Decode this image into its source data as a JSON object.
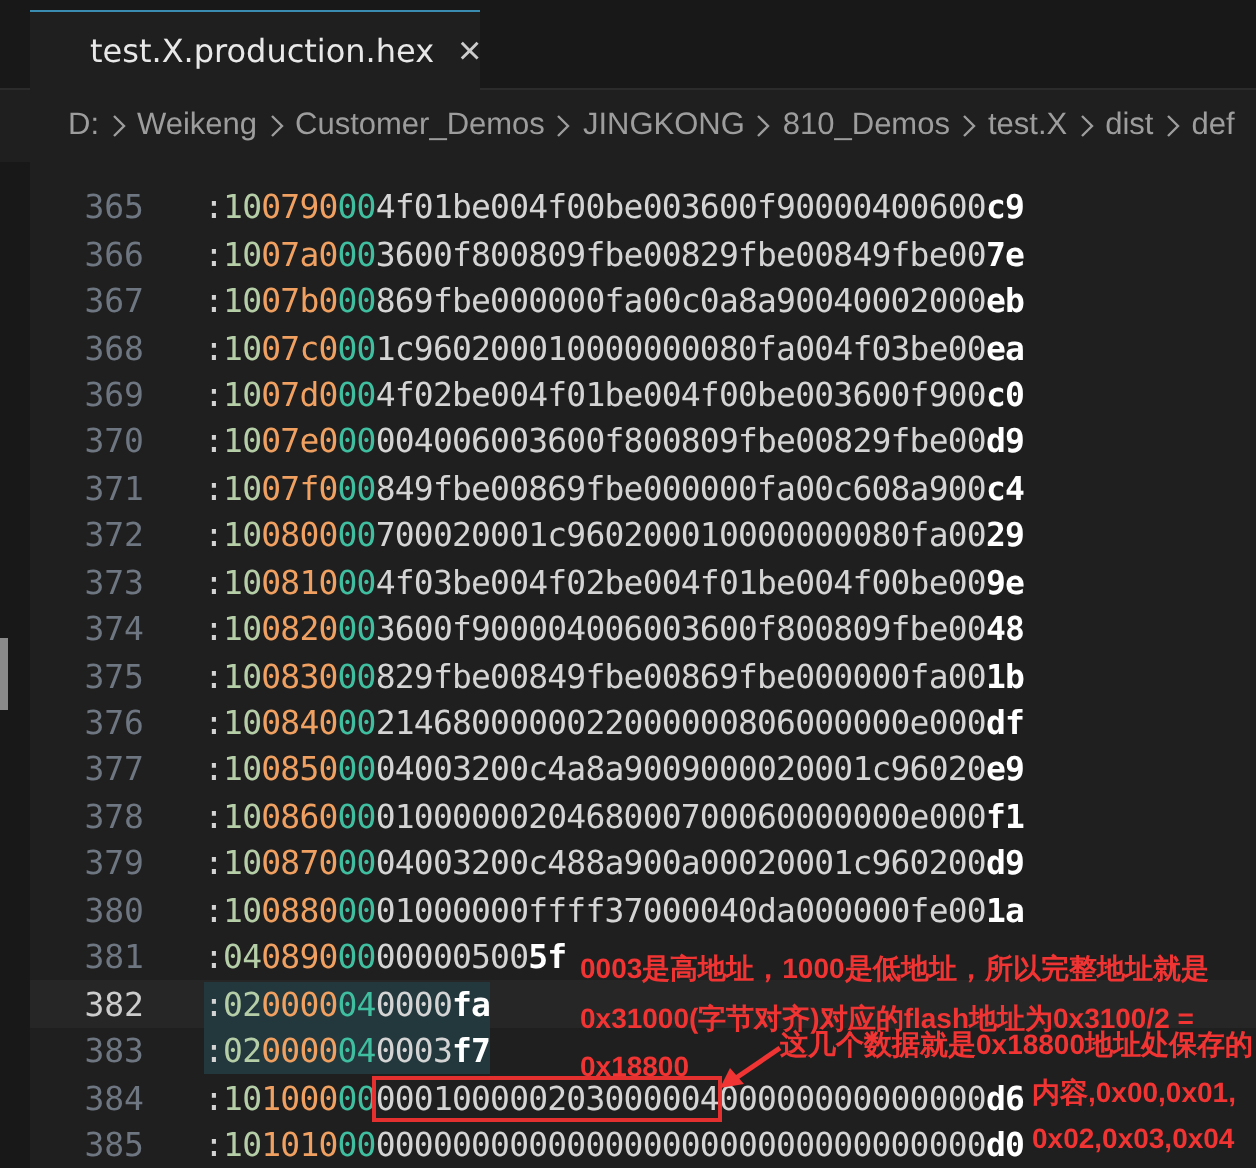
{
  "tab": {
    "title": "test.X.production.hex",
    "close": "×",
    "selected": true
  },
  "breadcrumbs": [
    "D:",
    "Weikeng",
    "Customer_Demos",
    "JINGKONG",
    "810_Demos",
    "test.X",
    "dist",
    "def"
  ],
  "lines": [
    {
      "number": "365",
      "colon": ":",
      "count": "10",
      "address": "0790",
      "type": "00",
      "data": "4f01be004f00be003600f90000400600",
      "checksum": "c9",
      "selected": false,
      "current": false
    },
    {
      "number": "366",
      "colon": ":",
      "count": "10",
      "address": "07a0",
      "type": "00",
      "data": "3600f800809fbe00829fbe00849fbe00",
      "checksum": "7e",
      "selected": false,
      "current": false
    },
    {
      "number": "367",
      "colon": ":",
      "count": "10",
      "address": "07b0",
      "type": "00",
      "data": "869fbe000000fa00c0a8a90040002000",
      "checksum": "eb",
      "selected": false,
      "current": false
    },
    {
      "number": "368",
      "colon": ":",
      "count": "10",
      "address": "07c0",
      "type": "00",
      "data": "1c960200010000000080fa004f03be00",
      "checksum": "ea",
      "selected": false,
      "current": false
    },
    {
      "number": "369",
      "colon": ":",
      "count": "10",
      "address": "07d0",
      "type": "00",
      "data": "4f02be004f01be004f00be003600f900",
      "checksum": "c0",
      "selected": false,
      "current": false
    },
    {
      "number": "370",
      "colon": ":",
      "count": "10",
      "address": "07e0",
      "type": "00",
      "data": "004006003600f800809fbe00829fbe00",
      "checksum": "d9",
      "selected": false,
      "current": false
    },
    {
      "number": "371",
      "colon": ":",
      "count": "10",
      "address": "07f0",
      "type": "00",
      "data": "849fbe00869fbe000000fa00c608a900",
      "checksum": "c4",
      "selected": false,
      "current": false
    },
    {
      "number": "372",
      "colon": ":",
      "count": "10",
      "address": "0800",
      "type": "00",
      "data": "700020001c960200010000000080fa00",
      "checksum": "29",
      "selected": false,
      "current": false
    },
    {
      "number": "373",
      "colon": ":",
      "count": "10",
      "address": "0810",
      "type": "00",
      "data": "4f03be004f02be004f01be004f00be00",
      "checksum": "9e",
      "selected": false,
      "current": false
    },
    {
      "number": "374",
      "colon": ":",
      "count": "10",
      "address": "0820",
      "type": "00",
      "data": "3600f900004006003600f800809fbe00",
      "checksum": "48",
      "selected": false,
      "current": false
    },
    {
      "number": "375",
      "colon": ":",
      "count": "10",
      "address": "0830",
      "type": "00",
      "data": "829fbe00849fbe00869fbe000000fa00",
      "checksum": "1b",
      "selected": false,
      "current": false
    },
    {
      "number": "376",
      "colon": ":",
      "count": "10",
      "address": "0840",
      "type": "00",
      "data": "2146800000022000000806000000e000",
      "checksum": "df",
      "selected": false,
      "current": false
    },
    {
      "number": "377",
      "colon": ":",
      "count": "10",
      "address": "0850",
      "type": "00",
      "data": "04003200c4a8a9009000020001c96020",
      "checksum": "e9",
      "selected": false,
      "current": false
    },
    {
      "number": "378",
      "colon": ":",
      "count": "10",
      "address": "0860",
      "type": "00",
      "data": "0100000020468000700060000000e000",
      "checksum": "f1",
      "selected": false,
      "current": false
    },
    {
      "number": "379",
      "colon": ":",
      "count": "10",
      "address": "0870",
      "type": "00",
      "data": "04003200c488a900a00020001c960200",
      "checksum": "d9",
      "selected": false,
      "current": false
    },
    {
      "number": "380",
      "colon": ":",
      "count": "10",
      "address": "0880",
      "type": "00",
      "data": "01000000ffff37000040da000000fe00",
      "checksum": "1a",
      "selected": false,
      "current": false
    },
    {
      "number": "381",
      "colon": ":",
      "count": "04",
      "address": "0890",
      "type": "00",
      "data": "00000500",
      "checksum": "5f",
      "selected": false,
      "current": false
    },
    {
      "number": "382",
      "colon": ":",
      "count": "02",
      "address": "0000",
      "type": "04",
      "data": "0000",
      "checksum": "fa",
      "selected": true,
      "current": true
    },
    {
      "number": "383",
      "colon": ":",
      "count": "02",
      "address": "0000",
      "type": "04",
      "data": "0003",
      "checksum": "f7",
      "selected": true,
      "current": false
    },
    {
      "number": "384",
      "colon": ":",
      "count": "10",
      "address": "1000",
      "type": "00",
      "boxed": "000100000203000004",
      "rest": "00000000000000",
      "checksum": "d6",
      "selected": false,
      "current": false
    },
    {
      "number": "385",
      "colon": ":",
      "count": "10",
      "address": "1010",
      "type": "00",
      "data": "00000000000000000000000000000000",
      "checksum": "d0",
      "selected": false,
      "current": false
    }
  ],
  "annotations": [
    {
      "kind": "note",
      "lines": [
        "0003是高地址，1000是低地址，所以完整地址就是",
        "0x31000(字节对齐)对应的flash地址为0x3100/2 =",
        "0x18800"
      ]
    },
    {
      "kind": "arrow-note",
      "lines": [
        "这几个数据就是0x18800地址处保存的",
        "内容,0x00,0x01,",
        "0x02,0x03,0x04"
      ]
    }
  ]
}
